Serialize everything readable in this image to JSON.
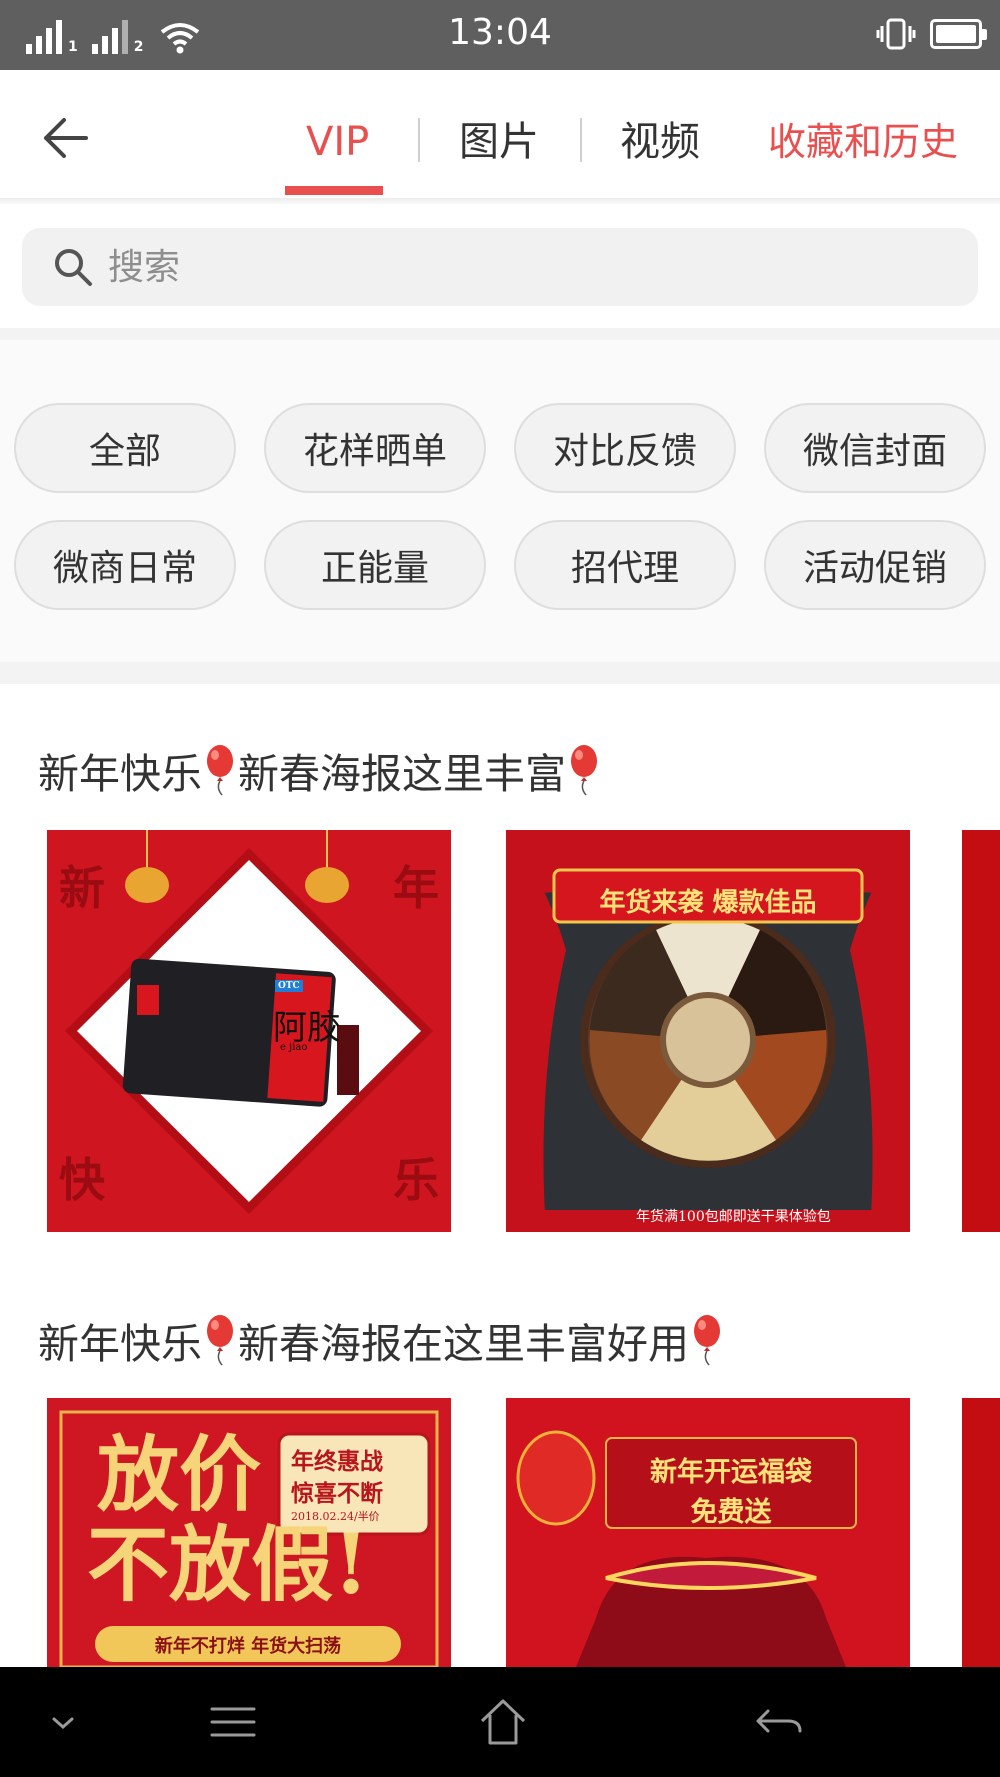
{
  "status_bar": {
    "time": "13:04",
    "sim1_label": "1",
    "sim2_label": "2",
    "battery_level": 1.0
  },
  "header": {
    "tabs": [
      {
        "label": "VIP",
        "active": true
      },
      {
        "label": "图片",
        "active": false
      },
      {
        "label": "视频",
        "active": false
      }
    ],
    "right_link": "收藏和历史",
    "accent_color": "#ea4f4f"
  },
  "search": {
    "placeholder": "搜索"
  },
  "categories": [
    "全部",
    "花样晒单",
    "对比反馈",
    "微信封面",
    "微商日常",
    "正能量",
    "招代理",
    "活动促销"
  ],
  "sections": [
    {
      "title": "新年快乐🎈新春海报这里丰富🎈",
      "title_parts": [
        "新年快乐",
        "新春海报这里丰富"
      ],
      "cards": [
        {
          "corner_chars": [
            "新",
            "年",
            "快",
            "乐"
          ],
          "product_brand": "阿胶",
          "product_sub": "e jiao",
          "product_badge": "OTC"
        },
        {
          "banner": "年货来袭 爆款佳品",
          "footer": "年货满100包邮即送干果体验包"
        }
      ]
    },
    {
      "title": "新年快乐🎈新春海报在这里丰富好用🎈",
      "title_parts": [
        "新年快乐",
        "新春海报在这里丰富好用"
      ],
      "cards": [
        {
          "headline_1": "放价",
          "headline_2": "不放假!",
          "stamp_1": "年终惠战",
          "stamp_2": "惊喜不断",
          "stamp_date": "2018.02.24/半价",
          "ribbon": "新年不打烊 年货大扫荡"
        },
        {
          "banner_1": "新年开运福袋",
          "banner_2": "免费送"
        }
      ]
    }
  ],
  "nav_bar": {
    "buttons": [
      "collapse-icon",
      "menu-icon",
      "home-icon",
      "back-icon"
    ]
  }
}
